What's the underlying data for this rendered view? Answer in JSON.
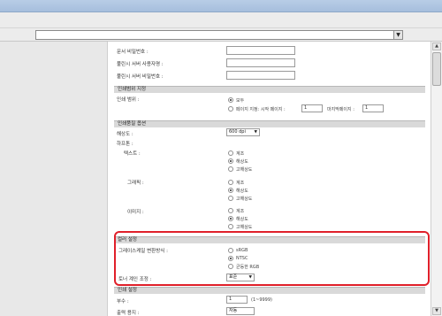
{
  "url": {
    "value": ""
  },
  "security": {
    "doc_password_label": "문서 비밀번호 :",
    "pull_user_id_label": "풀린시 서버 사용자명 :",
    "pull_password_label": "풀린시 서버 비밀번호 :"
  },
  "print_range": {
    "header": "인쇄범위 지정",
    "label": "인쇄 범위 :",
    "all": "모두",
    "pages_prefix": "페이지 지정: 시작 페이지 :",
    "pages_from": "1",
    "last_label": "마지막페이지 :",
    "pages_to": "1"
  },
  "quality": {
    "header": "인쇄품질 옵션",
    "resolution_label": "해상도 :",
    "resolution_value": "600 dpi",
    "halftone_label": "하프톤 :",
    "text_label": "텍스트 :",
    "graphics_label": "그래픽 :",
    "image_label": "이미지 :",
    "options": [
      "계조",
      "해상도",
      "고해상도"
    ]
  },
  "color": {
    "header": "컬러 설정",
    "grayscale_label": "그레이스케일 변환방식 :",
    "grayscale_options": [
      "sRGB",
      "NTSC",
      "균등한 RGB"
    ],
    "toner_label": "토너 계인 조정 :",
    "toner_value": "표준"
  },
  "print_settings": {
    "header": "인쇄 설정",
    "copies_label": "부수 :",
    "copies_value": "1",
    "copies_hint": "(1~9999)",
    "output_label": "출력 용지 :",
    "output_value": "자동"
  }
}
